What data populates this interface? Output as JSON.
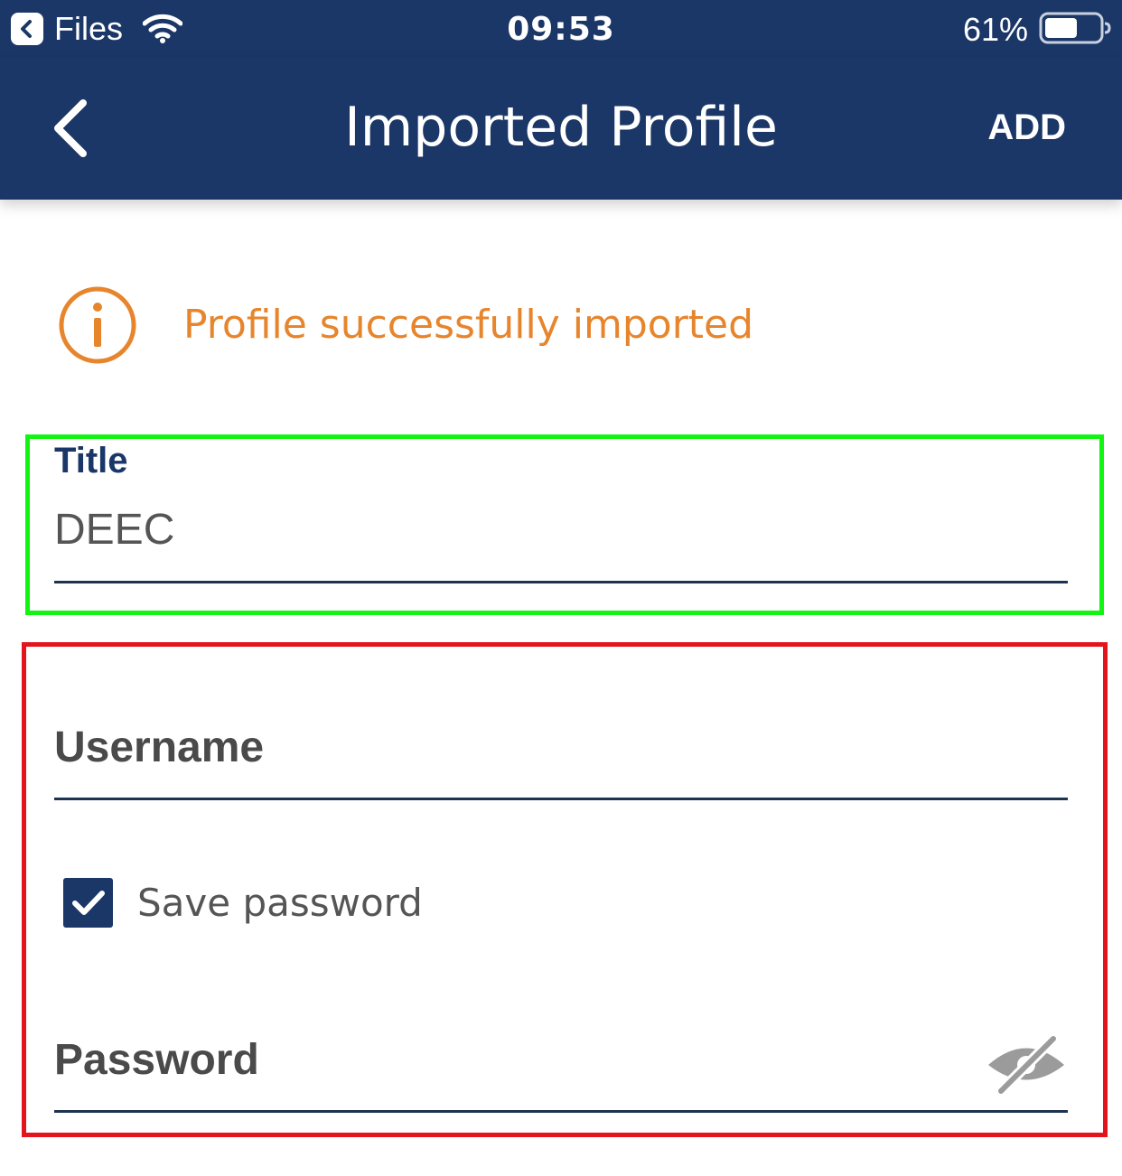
{
  "status_bar": {
    "back_app_label": "Files",
    "time": "09:53",
    "battery_percent": "61%",
    "battery_level": 0.61,
    "icons": [
      "back-app-icon",
      "wifi-icon",
      "battery-icon"
    ]
  },
  "nav": {
    "title": "Imported Profile",
    "add_label": "ADD",
    "back_icon": "chevron-left-icon"
  },
  "banner": {
    "message": "Profile successfully imported",
    "icon": "info-icon"
  },
  "form": {
    "title_label": "Title",
    "title_value": "DEEC",
    "username_placeholder": "Username",
    "save_password_label": "Save password",
    "save_password_checked": true,
    "password_placeholder": "Password",
    "password_visibility_icon": "eye-slash-icon"
  },
  "colors": {
    "header_bg": "#1b3767",
    "accent_orange": "#e7852d",
    "annotation_green": "#12f512",
    "annotation_red": "#e3141b"
  }
}
